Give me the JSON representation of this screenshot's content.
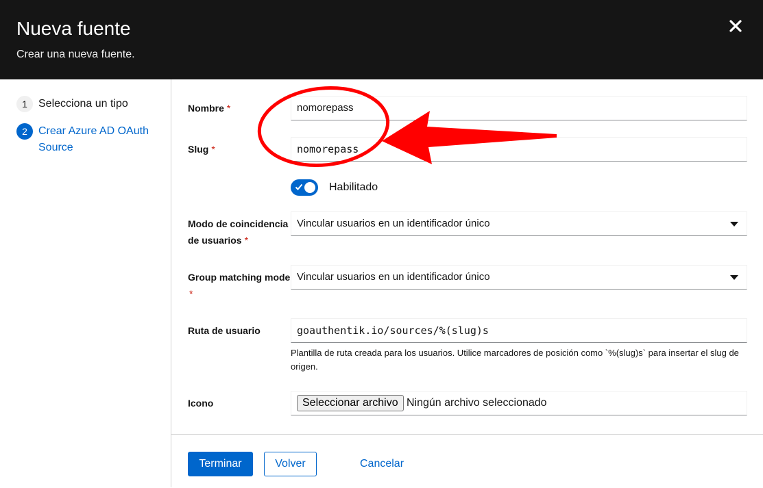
{
  "header": {
    "title": "Nueva fuente",
    "subtitle": "Crear una nueva fuente."
  },
  "steps": [
    {
      "number": "1",
      "label": "Selecciona un tipo",
      "active": false
    },
    {
      "number": "2",
      "label": "Crear Azure AD OAuth Source",
      "active": true
    }
  ],
  "form": {
    "name": {
      "label": "Nombre",
      "required": "*",
      "value": "nomorepass"
    },
    "slug": {
      "label": "Slug",
      "required": "*",
      "value": "nomorepass"
    },
    "enabled": {
      "label": "Habilitado",
      "checked": true
    },
    "user_matching": {
      "label": "Modo de coincidencia de usuarios",
      "required": "*",
      "value": "Vincular usuarios en un identificador único"
    },
    "group_matching": {
      "label": "Group matching mode",
      "required": "*",
      "value": "Vincular usuarios en un identificador único"
    },
    "user_path": {
      "label": "Ruta de usuario",
      "value": "goauthentik.io/sources/%(slug)s",
      "help": "Plantilla de ruta creada para los usuarios. Utilice marcadores de posición como `%(slug)s` para insertar el slug de origen."
    },
    "icon": {
      "label": "Icono",
      "button": "Seleccionar archivo",
      "status": "Ningún archivo seleccionado"
    }
  },
  "footer": {
    "finish": "Terminar",
    "back": "Volver",
    "cancel": "Cancelar"
  },
  "colors": {
    "header_bg": "#151515",
    "accent": "#0066cc",
    "required": "#c9190b",
    "annotation": "#ff0000"
  }
}
